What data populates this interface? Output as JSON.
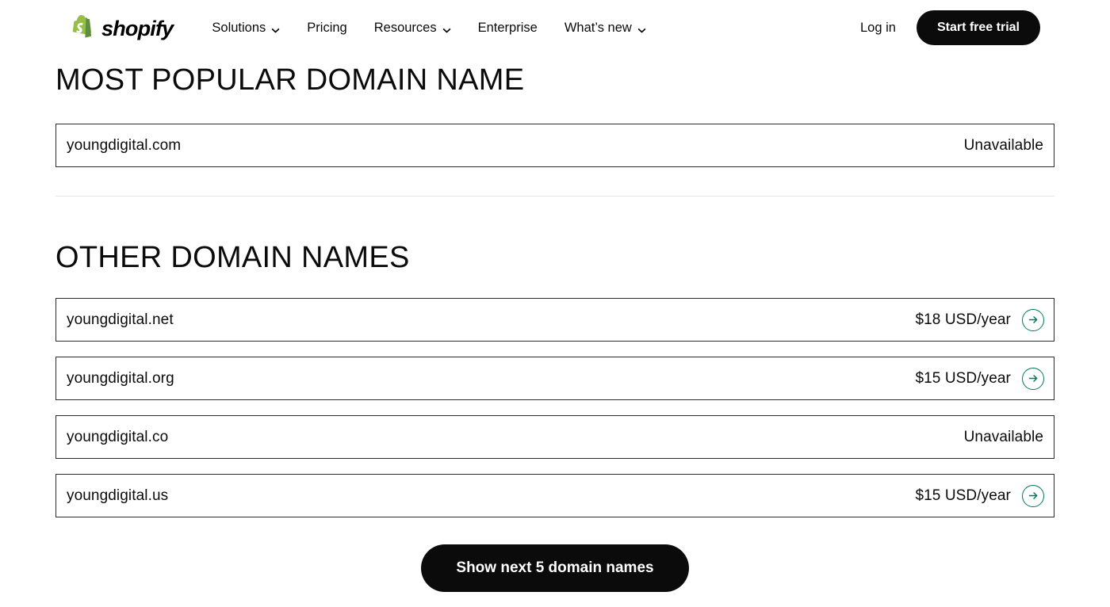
{
  "header": {
    "brand": {
      "logo_icon": "shopify-bag-icon",
      "wordmark": "shopify",
      "green_dark": "#5a8e22",
      "green_light": "#95bf47"
    },
    "nav": [
      {
        "label": "Solutions",
        "has_dropdown": true,
        "icon": "chevron-down-icon"
      },
      {
        "label": "Pricing",
        "has_dropdown": false,
        "icon": ""
      },
      {
        "label": "Resources",
        "has_dropdown": true,
        "icon": "chevron-down-icon"
      },
      {
        "label": "Enterprise",
        "has_dropdown": false,
        "icon": ""
      },
      {
        "label": "What’s new",
        "has_dropdown": true,
        "icon": "chevron-down-icon"
      }
    ],
    "login_label": "Log in",
    "cta_label": "Start free trial",
    "cta_color": "#0b0b0b"
  },
  "main": {
    "popular_section": {
      "title": "MOST POPULAR DOMAIN NAME",
      "rows": [
        {
          "domain": "youngdigital.com",
          "status": "Unavailable",
          "price": "",
          "available": false
        }
      ]
    },
    "other_section": {
      "title": "OTHER DOMAIN NAMES",
      "rows": [
        {
          "domain": "youngdigital.net",
          "status": "",
          "price": "$18 USD/year",
          "available": true,
          "icon": "arrow-right-icon"
        },
        {
          "domain": "youngdigital.org",
          "status": "",
          "price": "$15 USD/year",
          "available": true,
          "icon": "arrow-right-icon"
        },
        {
          "domain": "youngdigital.co",
          "status": "Unavailable",
          "price": "",
          "available": false,
          "icon": ""
        },
        {
          "domain": "youngdigital.us",
          "status": "",
          "price": "$15 USD/year",
          "available": true,
          "icon": "arrow-right-icon"
        }
      ]
    },
    "show_more_label": "Show next 5 domain names",
    "accent_green": "#007a5c"
  }
}
